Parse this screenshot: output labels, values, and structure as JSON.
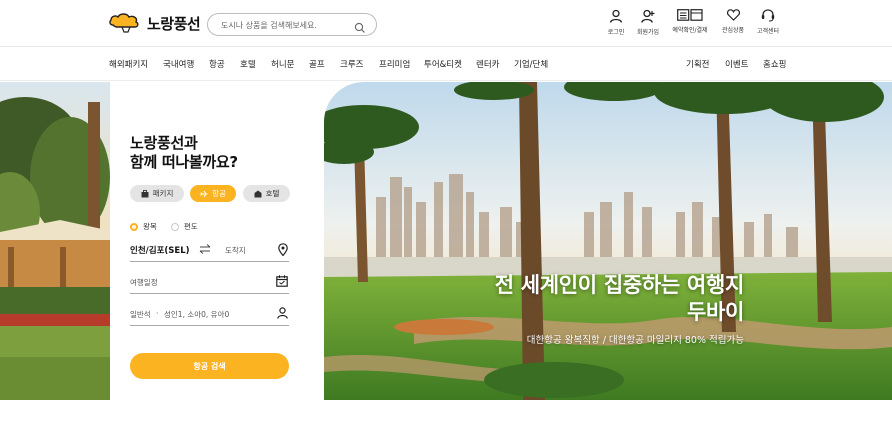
{
  "brand": {
    "name": "노랑풍선",
    "accent": "#fbb321"
  },
  "search": {
    "placeholder": "도시나 상품을 검색해보세요."
  },
  "utility": [
    {
      "label": "로그인",
      "icon": "person-icon"
    },
    {
      "label": "회원가입",
      "icon": "person-add-icon"
    },
    {
      "label": "예약확인/결제",
      "icon": "booking-icon"
    },
    {
      "label": "관심상품",
      "icon": "heart-icon"
    },
    {
      "label": "고객센터",
      "icon": "headset-icon"
    }
  ],
  "nav": {
    "left": [
      "해외패키지",
      "국내여행",
      "항공",
      "호텔",
      "허니문",
      "골프",
      "크루즈",
      "프리미엄",
      "투어&티켓",
      "렌터카",
      "기업/단체"
    ],
    "right": [
      "기획전",
      "이벤트",
      "홈쇼핑"
    ]
  },
  "panel": {
    "title_line1": "노랑풍선과",
    "title_line2": "함께 떠나볼까요?",
    "tabs": [
      {
        "label": "패키지",
        "active": false,
        "icon": "suitcase-icon"
      },
      {
        "label": "항공",
        "active": true,
        "icon": "plane-icon"
      },
      {
        "label": "호텔",
        "active": false,
        "icon": "hotel-icon"
      }
    ],
    "trip_types": [
      {
        "label": "왕복",
        "selected": true
      },
      {
        "label": "편도",
        "selected": false
      }
    ],
    "origin": "인천/김포(SEL)",
    "destination_placeholder": "도착지",
    "date_placeholder": "여행일정",
    "cabin": "일반석",
    "passengers": "성인1, 소아0, 유아0",
    "search_button": "항공 검색"
  },
  "hero": {
    "headline_line1": "전 세계인이 집중하는 여행지",
    "headline_line2": "두바이",
    "subtext": "대한항공 왕복직항 / 대한항공 마일리지 80% 적립가능"
  }
}
